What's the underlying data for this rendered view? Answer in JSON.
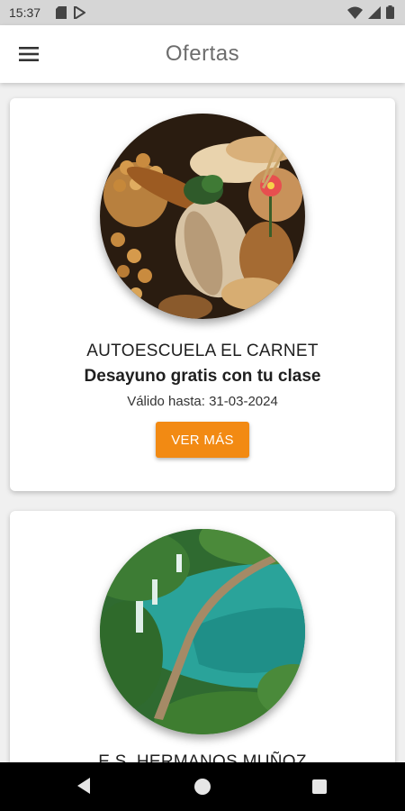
{
  "status_bar": {
    "time": "15:37",
    "icons": [
      "sd-card-icon",
      "play-store-icon",
      "wifi-icon",
      "signal-icon",
      "battery-icon"
    ]
  },
  "app_bar": {
    "title": "Ofertas",
    "menu_icon": "hamburger-menu-icon"
  },
  "offers": [
    {
      "image": "bread-pastries-photo",
      "company": "AUTOESCUELA EL CARNET",
      "title": "Desayuno gratis con tu clase",
      "valid_until": "Válido hasta: 31-03-2024",
      "button_label": "VER MÁS"
    },
    {
      "image": "lake-waterfall-boardwalk-photo",
      "company": "E.S. HERMANOS MUÑOZ"
    }
  ],
  "nav_bar": {
    "icons": [
      "back-icon",
      "home-icon",
      "recents-icon"
    ]
  },
  "colors": {
    "accent": "#f28a13",
    "status_bar": "#d6d6d6",
    "background": "#f0f0f0"
  }
}
